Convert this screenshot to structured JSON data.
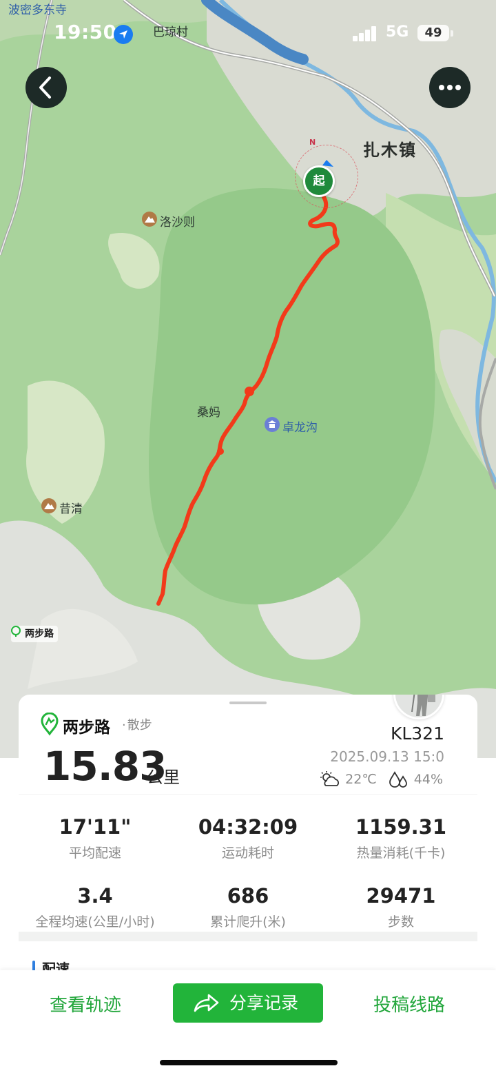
{
  "status_bar": {
    "time": "19:50",
    "network": "5G",
    "battery": "49"
  },
  "map": {
    "labels": {
      "top_left_place": "波密多东寺",
      "village": "巴琼村",
      "town": "扎木镇",
      "peak_1": "洛沙则",
      "area": "桑妈",
      "scenic": "卓龙沟",
      "peak_2": "昔清"
    },
    "start_marker": "起",
    "compass": "N",
    "watermark": "两步路"
  },
  "record": {
    "brand": "两步路",
    "activity_type": "散步",
    "distance": "15.83",
    "distance_unit": "公里",
    "username": "KL321",
    "date": "2025.09.13 15:0",
    "temperature": "22℃",
    "humidity": "44%"
  },
  "stats": [
    {
      "value": "17'11\"",
      "label": "平均配速"
    },
    {
      "value": "04:32:09",
      "label": "运动耗时"
    },
    {
      "value": "1159.31",
      "label": "热量消耗(千卡)"
    },
    {
      "value": "3.4",
      "label": "全程均速(公里/小时)"
    },
    {
      "value": "686",
      "label": "累计爬升(米)"
    },
    {
      "value": "29471",
      "label": "步数"
    }
  ],
  "section_title": "配速",
  "actions": {
    "view_track": "查看轨迹",
    "share": "分享记录",
    "submit_route": "投稿线路"
  },
  "colors": {
    "track": "#f23a1a",
    "accent": "#22b43a",
    "map_green": "#a9d39c"
  }
}
